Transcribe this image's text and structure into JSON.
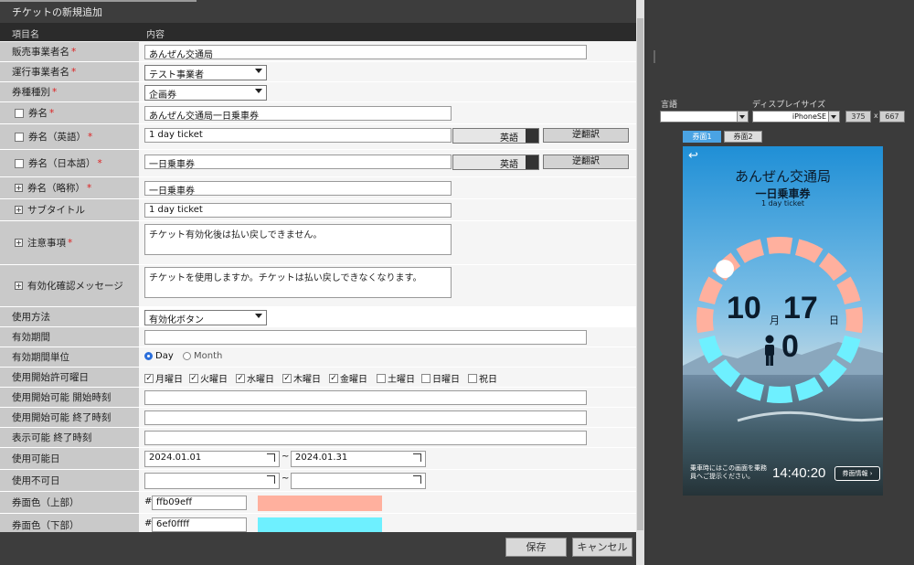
{
  "header": {
    "title": "チケットの新規追加"
  },
  "columns": {
    "field": "項目名",
    "content": "内容"
  },
  "fields": {
    "seller": {
      "label": "販売事業者名",
      "value": "あんぜん交通局"
    },
    "operator": {
      "label": "運行事業者名",
      "value": "テスト事業者"
    },
    "ticket_type": {
      "label": "券種種別",
      "value": "企画券"
    },
    "ticket_name": {
      "label": "券名",
      "value": "あんぜん交通局一日乗車券"
    },
    "ticket_name_en": {
      "label": "券名（英語）",
      "value": "1 day ticket",
      "lang": "英語",
      "button": "逆翻訳"
    },
    "ticket_name_ja": {
      "label": "券名（日本語）",
      "value": "一日乗車券",
      "lang": "英語",
      "button": "逆翻訳"
    },
    "short_name": {
      "label": "券名（略称）",
      "value": "一日乗車券"
    },
    "subtitle": {
      "label": "サブタイトル",
      "value": "1 day ticket"
    },
    "notes": {
      "label": "注意事項",
      "value": "チケット有効化後は払い戻しできません。"
    },
    "activate_msg": {
      "label": "有効化確認メッセージ",
      "value": "チケットを使用しますか。チケットは払い戻しできなくなります。"
    },
    "usage": {
      "label": "使用方法",
      "value": "有効化ボタン"
    },
    "validity": {
      "label": "有効期間",
      "value": ""
    },
    "validity_unit": {
      "label": "有効期間単位",
      "options": [
        "Day",
        "Month"
      ]
    },
    "weekdays": {
      "label": "使用開始許可曜日",
      "days": [
        "月曜日",
        "火曜日",
        "水曜日",
        "木曜日",
        "金曜日",
        "土曜日",
        "日曜日",
        "祝日"
      ],
      "checked": [
        true,
        true,
        true,
        true,
        true,
        false,
        false,
        false
      ]
    },
    "start_time": {
      "label": "使用開始可能 開始時刻",
      "value": ""
    },
    "end_time": {
      "label": "使用開始可能 終了時刻",
      "value": ""
    },
    "display_end": {
      "label": "表示可能 終了時刻",
      "value": ""
    },
    "usable_dates": {
      "label": "使用可能日",
      "from": "2024.01.01",
      "sep": "~",
      "to": "2024.01.31"
    },
    "unusable_dates": {
      "label": "使用不可日",
      "sep": "~"
    },
    "color_top": {
      "label": "券面色（上部）",
      "hash": "#",
      "value": "ffb09eff",
      "color": "#ffb09e"
    },
    "color_bottom": {
      "label": "券面色（下部）",
      "hash": "#",
      "value": "6ef0ffff",
      "color": "#6ef0ff"
    }
  },
  "footer": {
    "save": "保存",
    "cancel": "キャンセル"
  },
  "preview": {
    "lang_label": "言語",
    "display_label": "ディスプレイサイズ",
    "device": "iPhoneSE",
    "width": "375",
    "x": "x",
    "height": "667",
    "tabs": [
      "券面1",
      "券面2"
    ],
    "ticket": {
      "back": "↩",
      "org": "あんぜん交通局",
      "name": "一日乗車券",
      "sub": "1 day ticket",
      "month": "10",
      "month_unit": "月",
      "day": "17",
      "day_unit": "日",
      "count": "0",
      "notice": "乗車時にはこの画面を乗務員へご提示ください。",
      "time": "14:40:20",
      "detail_btn": "券面情報",
      "arc_top": "#ffb09e",
      "arc_bottom": "#6ef0ff"
    }
  }
}
